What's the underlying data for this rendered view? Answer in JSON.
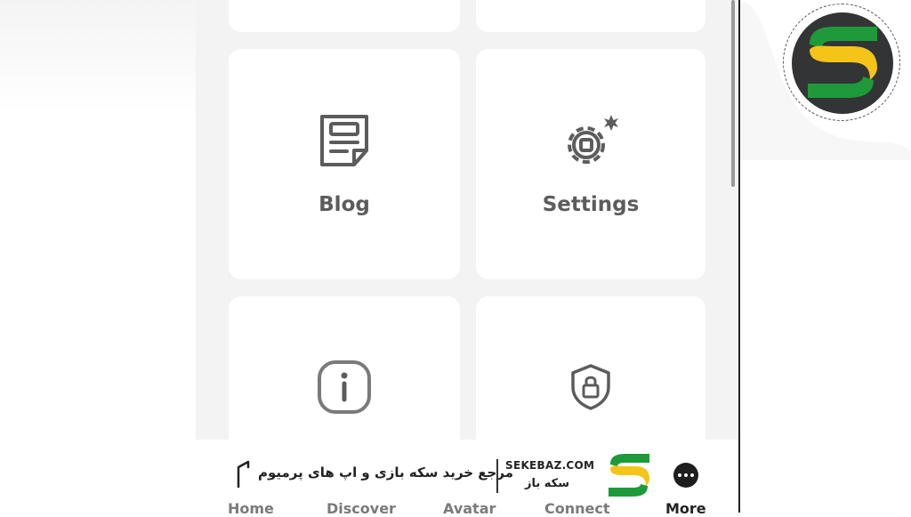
{
  "cards": [
    {
      "label": "Blog",
      "icon": "blog-icon"
    },
    {
      "label": "Settings",
      "icon": "settings-gear-icon"
    },
    {
      "label": "",
      "icon": "info-icon"
    },
    {
      "label": "",
      "icon": "shield-lock-icon"
    }
  ],
  "bottom_nav": {
    "home": "Home",
    "discover": "Discover",
    "avatar": "Avatar",
    "connect": "Connect",
    "more": "More"
  },
  "watermark": {
    "url": "SEKEBAZ.COM",
    "name": "سکه باز",
    "slogan": "مرجع خرید سکه بازی و اپ های پرمیوم"
  },
  "colors": {
    "logo_green": "#1f9a3a",
    "logo_yellow": "#f4c518",
    "logo_dark": "#333436",
    "label_gray": "#5c5c5c",
    "panel_bg": "#f3f3f4"
  }
}
